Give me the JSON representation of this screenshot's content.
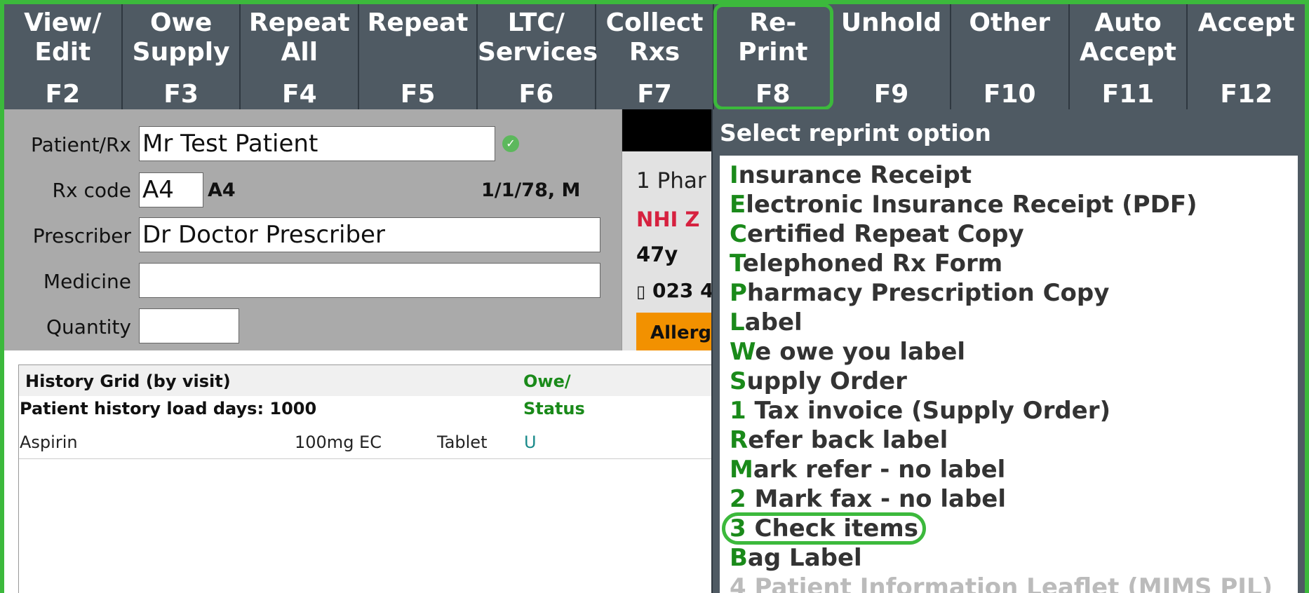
{
  "fkeys": [
    {
      "label": "View/\nEdit",
      "key": "F2"
    },
    {
      "label": "Owe\nSupply",
      "key": "F3"
    },
    {
      "label": "Repeat\nAll",
      "key": "F4"
    },
    {
      "label": "Repeat",
      "key": "F5"
    },
    {
      "label": "LTC/\nServices",
      "key": "F6"
    },
    {
      "label": "Collect\nRxs",
      "key": "F7"
    },
    {
      "label": "Re-\nPrint",
      "key": "F8"
    },
    {
      "label": "Unhold",
      "key": "F9"
    },
    {
      "label": "Other",
      "key": "F10"
    },
    {
      "label": "Auto\nAccept",
      "key": "F11"
    },
    {
      "label": "Accept",
      "key": "F12"
    }
  ],
  "form": {
    "patient_label": "Patient/Rx",
    "patient_value": "Mr Test Patient",
    "rx_code_label": "Rx code",
    "rx_code_value": "A4",
    "rx_code_echo": "A4",
    "dob_sex": "1/1/78, M",
    "prescriber_label": "Prescriber",
    "prescriber_value": "Dr Doctor Prescriber",
    "medicine_label": "Medicine",
    "medicine_value": "",
    "quantity_label": "Quantity",
    "quantity_value": ""
  },
  "summary": {
    "address": "1 Phar",
    "nhi": "NHI Z",
    "age": "47y",
    "phone": "023 4",
    "allergy": "Allerg"
  },
  "history": {
    "title": "History Grid (by visit)",
    "load_days": "Patient history load days: 1000",
    "owe_header_1": "Owe/",
    "owe_header_2": "Status",
    "rows": [
      {
        "medicine": "Aspirin",
        "strength": "100mg EC",
        "form": "Tablet",
        "status": "U"
      }
    ]
  },
  "popup": {
    "title": "Select reprint option",
    "options": [
      {
        "accel": "I",
        "rest": "nsurance Receipt"
      },
      {
        "accel": "E",
        "rest": "lectronic Insurance Receipt (PDF)"
      },
      {
        "accel": "C",
        "rest": "ertified Repeat Copy"
      },
      {
        "accel": "T",
        "rest": "elephoned Rx Form"
      },
      {
        "accel": "P",
        "rest": "harmacy Prescription Copy"
      },
      {
        "accel": "L",
        "rest": "abel"
      },
      {
        "accel": "W",
        "rest": "e owe you label"
      },
      {
        "accel": "S",
        "rest": "upply Order"
      },
      {
        "accel": "1",
        "rest": " Tax invoice (Supply Order)"
      },
      {
        "accel": "R",
        "rest": "efer back label"
      },
      {
        "accel": "M",
        "rest": "ark refer - no label"
      },
      {
        "accel": "2",
        "rest": " Mark fax - no label"
      },
      {
        "accel": "3",
        "rest": " Check items"
      },
      {
        "accel": "B",
        "rest": "ag Label"
      },
      {
        "accel": "4",
        "rest": " Patient Information Leaflet (MIMS PIL)"
      }
    ]
  },
  "colors": {
    "toolbar_bg": "#4f5a63",
    "highlight_green": "#3cb93c",
    "accelerator_green": "#1a8a1a",
    "nhi_red": "#d6213f",
    "allergy_orange": "#f29100"
  }
}
